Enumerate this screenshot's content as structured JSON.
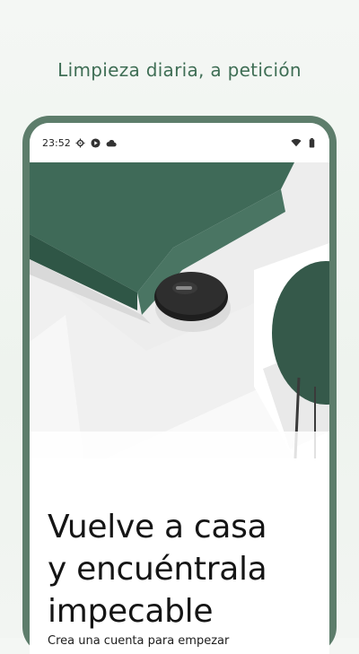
{
  "promo": {
    "headline": "Limpieza diaria, a petición"
  },
  "statusbar": {
    "time": "23:52"
  },
  "hero": {
    "title_lines": [
      "Vuelve a casa",
      "y encuéntrala",
      "impecable"
    ],
    "subtitle": "Crea una cuenta para empezar"
  },
  "colors": {
    "accent": "#3f6e55",
    "frame": "#5d7d6b",
    "sofa": "#3f6a58"
  }
}
